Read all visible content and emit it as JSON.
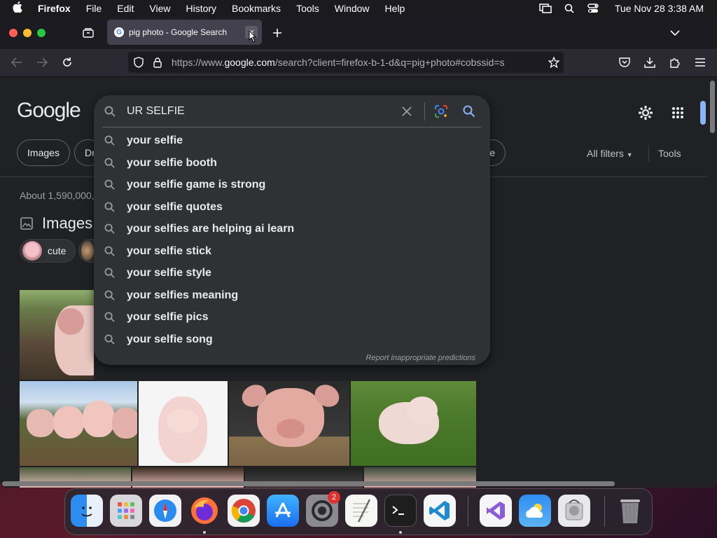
{
  "menubar": {
    "app": "Firefox",
    "items": [
      "File",
      "Edit",
      "View",
      "History",
      "Bookmarks",
      "Tools",
      "Window",
      "Help"
    ],
    "clock": "Tue Nov 28  3:38 AM"
  },
  "tab": {
    "title": "pig photo - Google Search",
    "close_glyph": "✕"
  },
  "url": {
    "prefix": "https://www.",
    "domain": "google.com",
    "rest": "/search?client=firefox-b-1-d&q=pig+photo#cobssid=s"
  },
  "google": {
    "logo": "Google",
    "chips": {
      "images": "Images",
      "partial": "Dr",
      "partial_right": "e"
    },
    "all_filters": "All filters",
    "tools": "Tools",
    "about": "About 1,590,000,",
    "images_title": "Images",
    "pills": [
      "cute"
    ]
  },
  "search": {
    "query": "UR SELFIE",
    "suggestions": [
      "your selfie",
      "your selfie booth",
      "your selfie game is strong",
      "your selfie quotes",
      "your selfies are helping ai learn",
      "your selfie stick",
      "your selfie style",
      "your selfies meaning",
      "your selfie pics",
      "your selfie song"
    ],
    "report": "Report inappropriate predictions"
  },
  "dock": {
    "badge": "2",
    "apps": [
      "finder-icon",
      "launchpad-icon",
      "safari-icon",
      "firefox-icon",
      "chrome-icon",
      "app-store-icon",
      "system-settings-icon",
      "textedit-icon",
      "terminal-icon",
      "vscode-icon",
      "visual-studio-icon",
      "weather-icon",
      "disk-utility-icon",
      "trash-icon"
    ]
  },
  "colors": {
    "accent": "#8ab4f8",
    "background": "#202124",
    "panel": "#303134"
  }
}
